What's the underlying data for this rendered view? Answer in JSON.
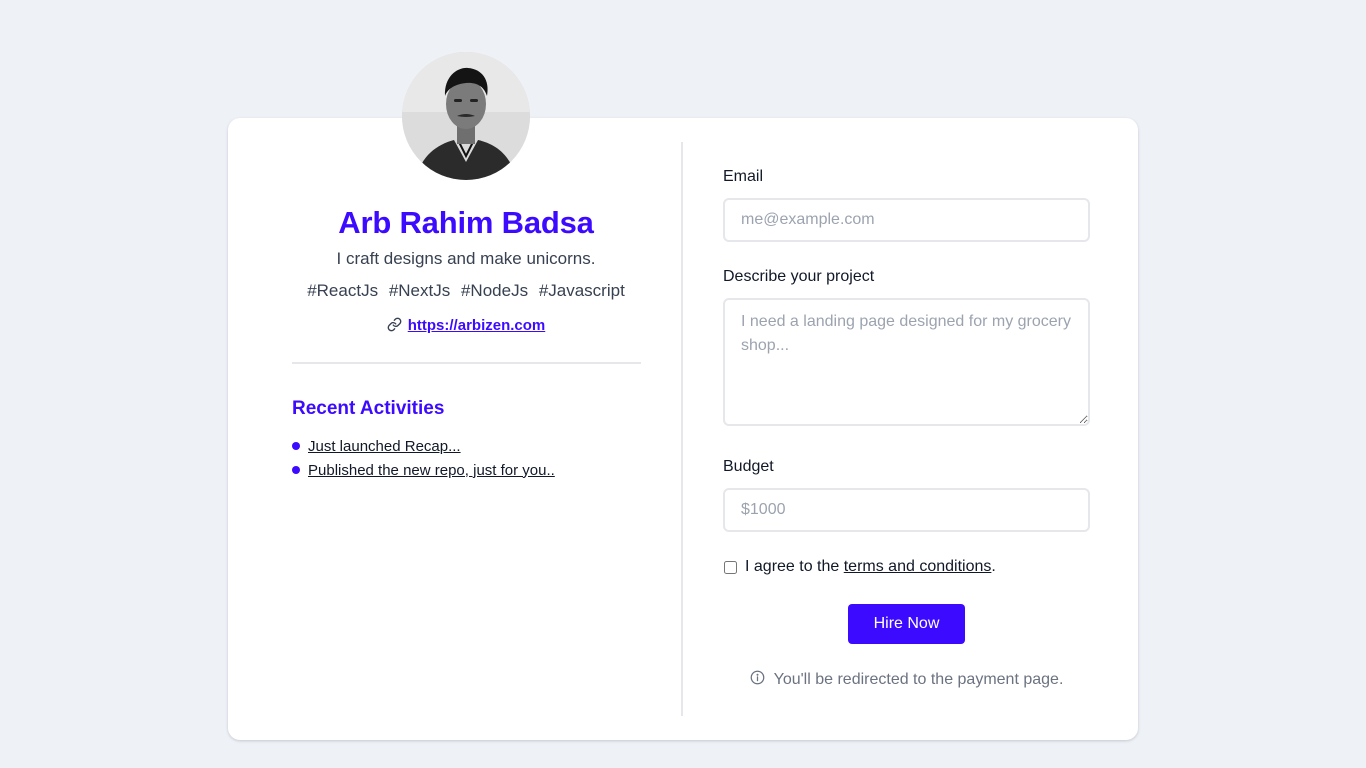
{
  "profile": {
    "name": "Arb Rahim Badsa",
    "tagline": "I craft designs and make unicorns.",
    "tags": [
      "#ReactJs",
      "#NextJs",
      "#NodeJs",
      "#Javascript"
    ],
    "website": "https://arbizen.com",
    "avatar_icon": "profile-photo",
    "link_icon": "link-icon"
  },
  "activities": {
    "title": "Recent Activities",
    "items": [
      "Just launched Recap...",
      "Published the new repo, just for you.."
    ]
  },
  "form": {
    "email_label": "Email",
    "email_placeholder": "me@example.com",
    "email_value": "",
    "project_label": "Describe your project",
    "project_placeholder": "I need a landing page designed for my grocery shop...",
    "project_value": "",
    "budget_label": "Budget",
    "budget_placeholder": "$1000",
    "budget_value": "",
    "agree_prefix": "I agree to the ",
    "agree_link": "terms and conditions",
    "agree_suffix": ".",
    "agree_checked": false,
    "submit_label": "Hire Now",
    "note": "You'll be redirected to the payment page.",
    "note_icon": "info-icon"
  },
  "colors": {
    "accent": "#3c0bff",
    "background": "#eef1f6",
    "card": "#ffffff",
    "muted_text": "#6b7280"
  }
}
